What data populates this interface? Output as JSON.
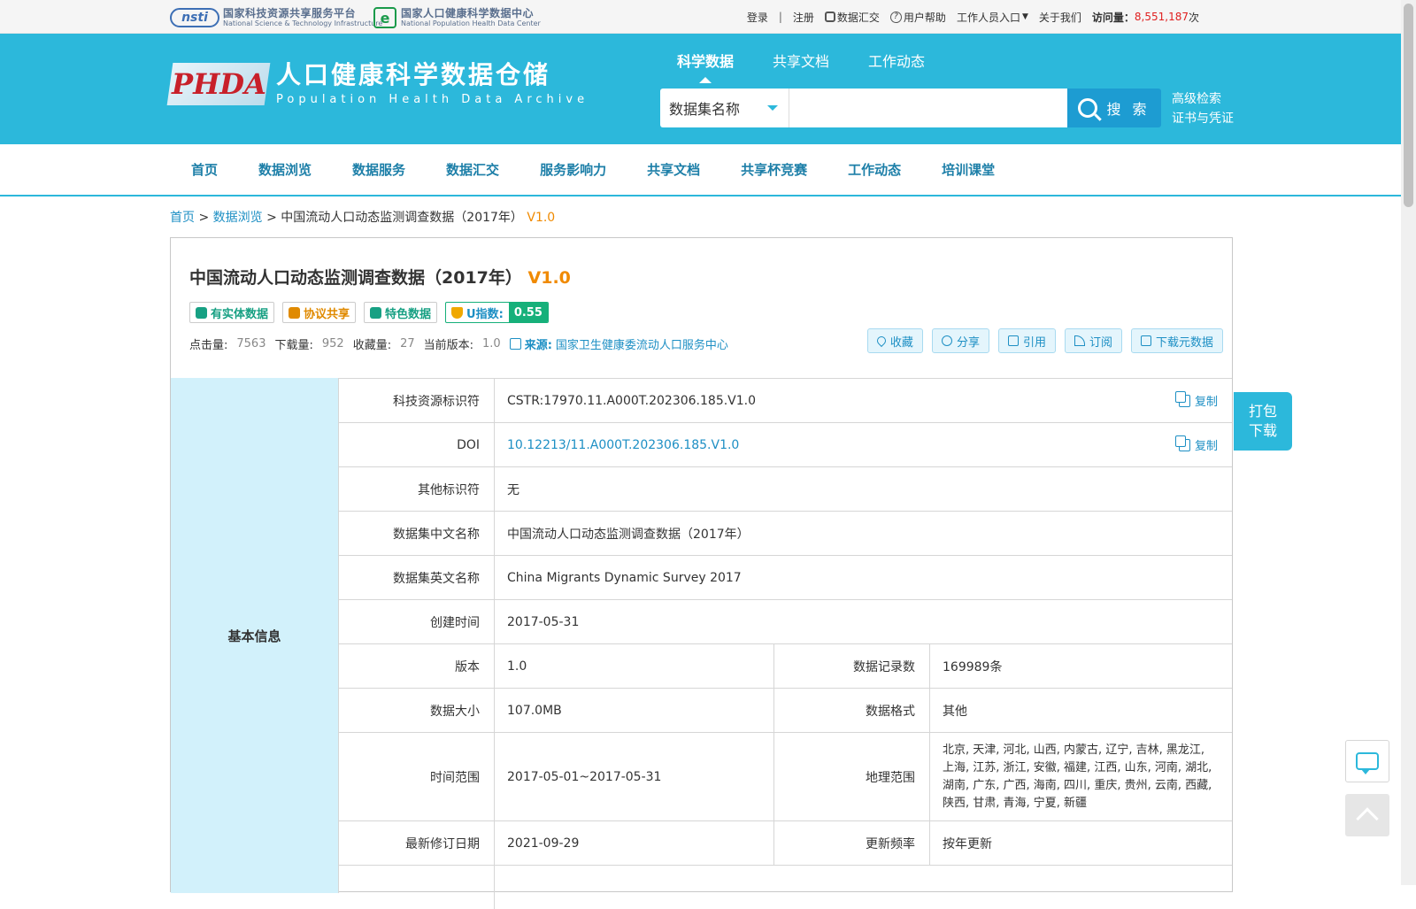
{
  "topbar": {
    "logo1_cn": "国家科技资源共享服务平台",
    "logo1_en": "National Science & Technology Infrastructure",
    "logo2_cn": "国家人口健康科学数据中心",
    "logo2_en": "National Population Health Data Center",
    "links": {
      "login": "登录",
      "sep": "|",
      "register": "注册",
      "submit": "数据汇交",
      "help": "用户帮助",
      "staff": "工作人员入口",
      "about": "关于我们",
      "visits_label": "访问量：",
      "visits_count": "8,551,187",
      "visits_unit": "次"
    }
  },
  "header": {
    "logo_mark": "PHDA",
    "title_cn": "人口健康科学数据仓储",
    "title_en": "Population  Health  Data  Archive",
    "tabs": [
      "科学数据",
      "共享文档",
      "工作动态"
    ],
    "search_type": "数据集名称",
    "search_placeholder": "",
    "search_button": "搜 索",
    "advanced_search": "高级检索",
    "certificate": "证书与凭证"
  },
  "nav": [
    "首页",
    "数据浏览",
    "数据服务",
    "数据汇交",
    "服务影响力",
    "共享文档",
    "共享杯竞赛",
    "工作动态",
    "培训课堂"
  ],
  "breadcrumb": {
    "home": "首页",
    "sep1": " > ",
    "browse": "数据浏览",
    "sep2": " > ",
    "current": "中国流动人口动态监测调查数据（2017年）",
    "version": "V1.0"
  },
  "dataset": {
    "title": "中国流动人口动态监测调查数据（2017年）",
    "version": "V1.0",
    "tags": {
      "entity": "有实体数据",
      "agreement": "协议共享",
      "featured": "特色数据",
      "u_index_label": "U指数:",
      "u_index_value": "0.55"
    },
    "stats": {
      "clicks_label": "点击量:",
      "clicks": "7563",
      "downloads_label": "下载量:",
      "downloads": "952",
      "favorites_label": "收藏量:",
      "favorites": "27",
      "current_version_label": "当前版本:",
      "current_version": "1.0",
      "source_label": "来源:",
      "source": "国家卫生健康委流动人口服务中心"
    },
    "actions": {
      "favorite": "收藏",
      "share": "分享",
      "cite": "引用",
      "subscribe": "订阅",
      "download_meta": "下载元数据"
    }
  },
  "info": {
    "section": "基本信息",
    "copy_label": "复制",
    "rows": {
      "cstr_k": "科技资源标识符",
      "cstr_v": "CSTR:17970.11.A000T.202306.185.V1.0",
      "doi_k": "DOI",
      "doi_v": "10.12213/11.A000T.202306.185.V1.0",
      "other_k": "其他标识符",
      "other_v": "无",
      "cn_name_k": "数据集中文名称",
      "cn_name_v": "中国流动人口动态监测调查数据（2017年）",
      "en_name_k": "数据集英文名称",
      "en_name_v": "China Migrants Dynamic Survey 2017",
      "created_k": "创建时间",
      "created_v": "2017-05-31",
      "version_k": "版本",
      "version_v": "1.0",
      "records_k": "数据记录数",
      "records_v": "169989条",
      "size_k": "数据大小",
      "size_v": "107.0MB",
      "format_k": "数据格式",
      "format_v": "其他",
      "time_k": "时间范围",
      "time_v": "2017-05-01~2017-05-31",
      "geo_k": "地理范围",
      "geo_v": "北京, 天津, 河北, 山西, 内蒙古, 辽宁, 吉林, 黑龙江, 上海, 江苏, 浙江, 安徽, 福建, 江西, 山东, 河南, 湖北, 湖南, 广东, 广西, 海南, 四川, 重庆, 贵州, 云南, 西藏, 陕西, 甘肃, 青海, 宁夏, 新疆",
      "revised_k": "最新修订日期",
      "revised_v": "2021-09-29",
      "freq_k": "更新频率",
      "freq_v": "按年更新"
    }
  },
  "float": {
    "pack_download_1": "打包",
    "pack_download_2": "下载"
  },
  "colors": {
    "header_bg": "#2cb8db",
    "accent_blue": "#1d8fc4",
    "version_orange": "#f08a00",
    "side_bg": "#d2f1fb"
  }
}
